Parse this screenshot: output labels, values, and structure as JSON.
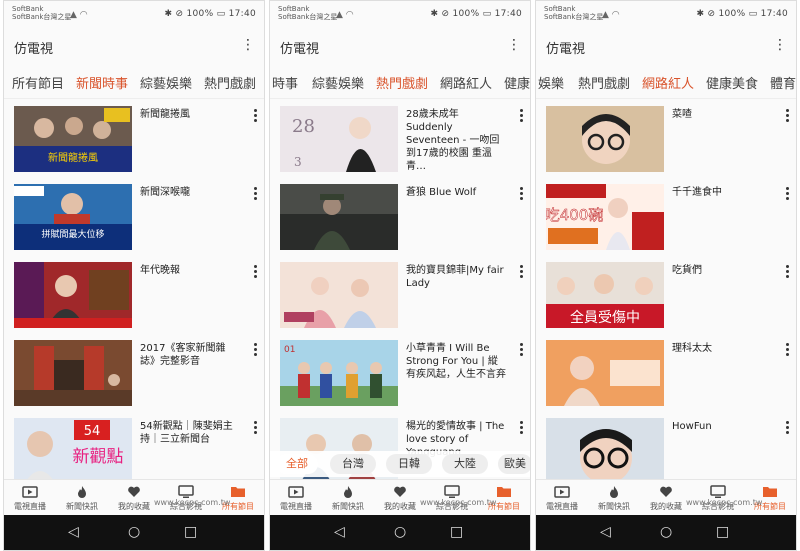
{
  "status": {
    "carrier1": "SoftBank",
    "carrier2": "SoftBank台灣之星",
    "battery": "100%",
    "time": "17:40"
  },
  "app": {
    "title": "仿電視"
  },
  "phones": [
    {
      "tabs": [
        {
          "label": "所有節目",
          "active": false
        },
        {
          "label": "新聞時事",
          "active": true
        },
        {
          "label": "綜藝娛樂",
          "active": false
        },
        {
          "label": "熱門戲劇",
          "active": false
        }
      ],
      "items": [
        {
          "title": "新聞龍捲風"
        },
        {
          "title": "新聞深喉嚨"
        },
        {
          "title": "年代晚報"
        },
        {
          "title": "2017《客家新聞雜誌》完整影音"
        },
        {
          "title": "54新觀點｜陳斐娟主持｜三立新聞台"
        }
      ],
      "thumb_text": [
        "新聞龍捲風",
        "拼賦間最大位移",
        "",
        "",
        "新觀點"
      ]
    },
    {
      "tabs": [
        {
          "label": "時事",
          "active": false
        },
        {
          "label": "綜藝娛樂",
          "active": false
        },
        {
          "label": "熱門戲劇",
          "active": true
        },
        {
          "label": "網路紅人",
          "active": false
        },
        {
          "label": "健康",
          "active": false
        }
      ],
      "items": [
        {
          "title": "28歲未成年 Suddenly Seventeen - 一吻回到17歲的校園 重溫青…"
        },
        {
          "title": "蒼狼 Blue Wolf"
        },
        {
          "title": "我的寶貝錦菲|My fair Lady"
        },
        {
          "title": "小草青青 I Will Be Strong For You | 縱有疾风起，人生不言弃"
        },
        {
          "title": "楊光的愛情故事 | The love story of Yangguang"
        }
      ],
      "chips": [
        {
          "label": "全部",
          "active": true
        },
        {
          "label": "台灣",
          "active": false
        },
        {
          "label": "日韓",
          "active": false
        },
        {
          "label": "大陸",
          "active": false
        },
        {
          "label": "歐美",
          "active": false
        }
      ]
    },
    {
      "tabs": [
        {
          "label": "娛樂",
          "active": false
        },
        {
          "label": "熱門戲劇",
          "active": false
        },
        {
          "label": "網路紅人",
          "active": true
        },
        {
          "label": "健康美食",
          "active": false
        },
        {
          "label": "體育",
          "active": false
        }
      ],
      "items": [
        {
          "title": "菜喳"
        },
        {
          "title": "千千進食中"
        },
        {
          "title": "吃貨們"
        },
        {
          "title": "理科太太"
        },
        {
          "title": "HowFun"
        }
      ],
      "thumb_text": [
        "",
        "吃400碗",
        "全員受傷中",
        "",
        ""
      ]
    }
  ],
  "nav": [
    {
      "label": "電視直播",
      "icon": "tv-play-icon"
    },
    {
      "label": "新聞快訊",
      "icon": "flame-icon"
    },
    {
      "label": "我的收藏",
      "icon": "heart-icon"
    },
    {
      "label": "綜合影視",
      "icon": "monitor-icon"
    },
    {
      "label": "所有節目",
      "icon": "folder-icon",
      "active": true
    }
  ],
  "watermark": "www.kocpc.com.tw",
  "colors": {
    "accent": "#e7602c",
    "text": "#222222"
  }
}
